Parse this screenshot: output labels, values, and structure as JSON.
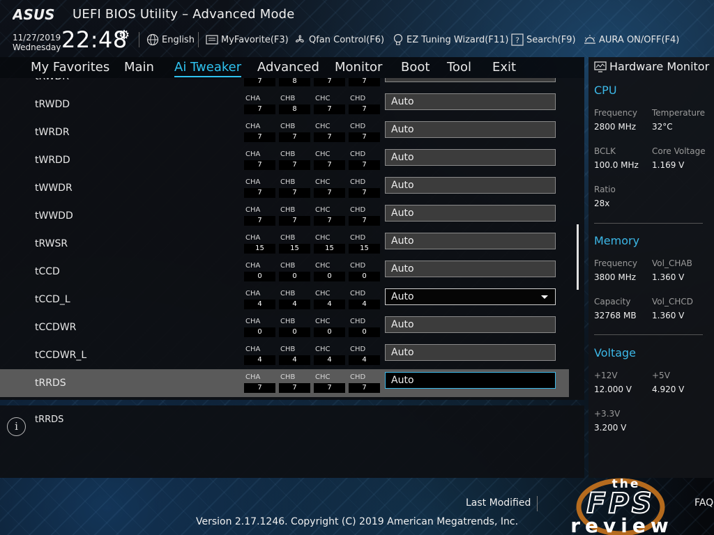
{
  "header": {
    "brand": "ASUS",
    "title": "UEFI BIOS Utility – Advanced Mode",
    "date": "11/27/2019",
    "day": "Wednesday",
    "time": "22:48",
    "toolbar": [
      {
        "label": "English",
        "icon": "globe-icon"
      },
      {
        "label": "MyFavorite(F3)",
        "icon": "favorite-icon"
      },
      {
        "label": "Qfan Control(F6)",
        "icon": "fan-icon"
      },
      {
        "label": "EZ Tuning Wizard(F11)",
        "icon": "bulb-icon"
      },
      {
        "label": "Search(F9)",
        "icon": "search-icon"
      },
      {
        "label": "AURA ON/OFF(F4)",
        "icon": "aura-icon"
      }
    ]
  },
  "tabs": [
    {
      "label": "My Favorites"
    },
    {
      "label": "Main"
    },
    {
      "label": "Ai Tweaker",
      "active": true
    },
    {
      "label": "Advanced"
    },
    {
      "label": "Monitor"
    },
    {
      "label": "Boot"
    },
    {
      "label": "Tool"
    },
    {
      "label": "Exit"
    }
  ],
  "channel_names": [
    "CHA",
    "CHB",
    "CHC",
    "CHD"
  ],
  "settings": [
    {
      "name": "tRWDR",
      "values": [
        "7",
        "8",
        "7",
        "7"
      ],
      "setting": "Auto",
      "partial": true
    },
    {
      "name": "tRWDD",
      "values": [
        "7",
        "8",
        "7",
        "7"
      ],
      "setting": "Auto"
    },
    {
      "name": "tWRDR",
      "values": [
        "7",
        "7",
        "7",
        "7"
      ],
      "setting": "Auto"
    },
    {
      "name": "tWRDD",
      "values": [
        "7",
        "7",
        "7",
        "7"
      ],
      "setting": "Auto"
    },
    {
      "name": "tWWDR",
      "values": [
        "7",
        "7",
        "7",
        "7"
      ],
      "setting": "Auto"
    },
    {
      "name": "tWWDD",
      "values": [
        "7",
        "7",
        "7",
        "7"
      ],
      "setting": "Auto"
    },
    {
      "name": "tRWSR",
      "values": [
        "15",
        "15",
        "15",
        "15"
      ],
      "setting": "Auto"
    },
    {
      "name": "tCCD",
      "values": [
        "0",
        "0",
        "0",
        "0"
      ],
      "setting": "Auto"
    },
    {
      "name": "tCCD_L",
      "values": [
        "4",
        "4",
        "4",
        "4"
      ],
      "setting": "Auto",
      "dropdown": true
    },
    {
      "name": "tCCDWR",
      "values": [
        "0",
        "0",
        "0",
        "0"
      ],
      "setting": "Auto"
    },
    {
      "name": "tCCDWR_L",
      "values": [
        "4",
        "4",
        "4",
        "4"
      ],
      "setting": "Auto"
    },
    {
      "name": "tRRDS",
      "values": [
        "7",
        "7",
        "7",
        "7"
      ],
      "setting": "Auto",
      "selected": true
    }
  ],
  "help": {
    "text": "tRRDS"
  },
  "hardware_monitor": {
    "title": "Hardware Monitor",
    "cpu": {
      "title": "CPU",
      "frequency_label": "Frequency",
      "frequency": "2800 MHz",
      "temperature_label": "Temperature",
      "temperature": "32°C",
      "bclk_label": "BCLK",
      "bclk": "100.0 MHz",
      "core_voltage_label": "Core Voltage",
      "core_voltage": "1.169 V",
      "ratio_label": "Ratio",
      "ratio": "28x"
    },
    "memory": {
      "title": "Memory",
      "frequency_label": "Frequency",
      "frequency": "3800 MHz",
      "vol_chab_label": "Vol_CHAB",
      "vol_chab": "1.360 V",
      "capacity_label": "Capacity",
      "capacity": "32768 MB",
      "vol_chcd_label": "Vol_CHCD",
      "vol_chcd": "1.360 V"
    },
    "voltage": {
      "title": "Voltage",
      "v12_label": "+12V",
      "v12": "12.000 V",
      "v5_label": "+5V",
      "v5": "4.920 V",
      "v33_label": "+3.3V",
      "v33": "3.200 V"
    }
  },
  "footer": {
    "last_modified": "Last Modified",
    "faq": "FAQ",
    "version": "Version 2.17.1246. Copyright (C) 2019 American Megatrends, Inc.",
    "watermark": "the FPS review"
  }
}
